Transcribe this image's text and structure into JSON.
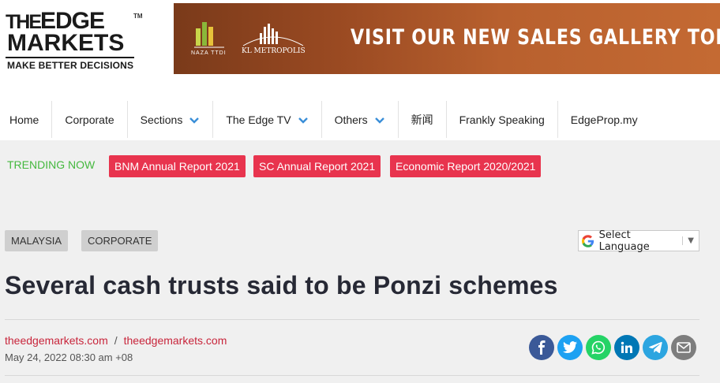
{
  "header": {
    "logo": {
      "line1_the": "THE",
      "line1_edge": "EDGE",
      "tm": "TM",
      "line2": "MARKETS",
      "tagline": "MAKE BETTER DECISIONS"
    },
    "banner": {
      "text": "VISIT OUR NEW SALES GALLERY TODAY",
      "naza_label": "NAZA TTDI",
      "kl_label": "KL METROPOLIS"
    }
  },
  "nav": {
    "items": [
      {
        "label": "Home"
      },
      {
        "label": "Corporate"
      },
      {
        "label": "Sections",
        "has_dropdown": true
      },
      {
        "label": "The Edge TV",
        "has_dropdown": true
      },
      {
        "label": "Others",
        "has_dropdown": true
      },
      {
        "label": "新闻"
      },
      {
        "label": "Frankly Speaking"
      },
      {
        "label": "EdgeProp.my"
      }
    ]
  },
  "trending": {
    "label": "TRENDING NOW",
    "tags": [
      "BNM Annual Report 2021",
      "SC Annual Report 2021",
      "Economic Report 2020/2021"
    ]
  },
  "article": {
    "categories": [
      "MALAYSIA",
      "CORPORATE"
    ],
    "language_select": "Select Language",
    "title": "Several cash trusts said to be Ponzi schemes",
    "byline": {
      "author1": "theedgemarkets.com",
      "separator": "/",
      "author2": "theedgemarkets.com"
    },
    "date": "May 24, 2022 08:30 am +08"
  },
  "share": {
    "icons": [
      "facebook-icon",
      "twitter-icon",
      "whatsapp-icon",
      "linkedin-icon",
      "telegram-icon",
      "email-icon"
    ]
  },
  "colors": {
    "accent_red": "#e8344e",
    "trending_green": "#44b83e",
    "byline_red": "#c8253b",
    "facebook": "#3b5998",
    "twitter": "#1da1f2",
    "whatsapp": "#25d366",
    "linkedin": "#0077b5",
    "telegram": "#2ca5e0",
    "email": "#7d7d7d"
  }
}
